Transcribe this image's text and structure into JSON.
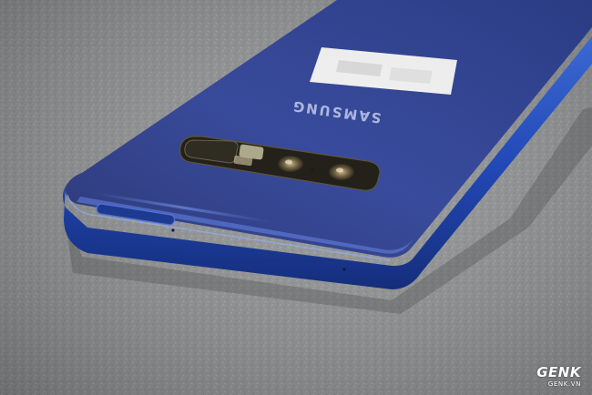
{
  "photo": {
    "subject": "phone",
    "brand_text": "SAMSUNG",
    "colors": {
      "carpet": "#8f9192",
      "phone_body": "#2a3d92",
      "phone_edge": "#1c3fa8",
      "camera_strip": "#1f1d15",
      "label_sticker": "#efefef"
    }
  },
  "watermark": {
    "brand": "GENK",
    "domain": "GENK.VN"
  }
}
